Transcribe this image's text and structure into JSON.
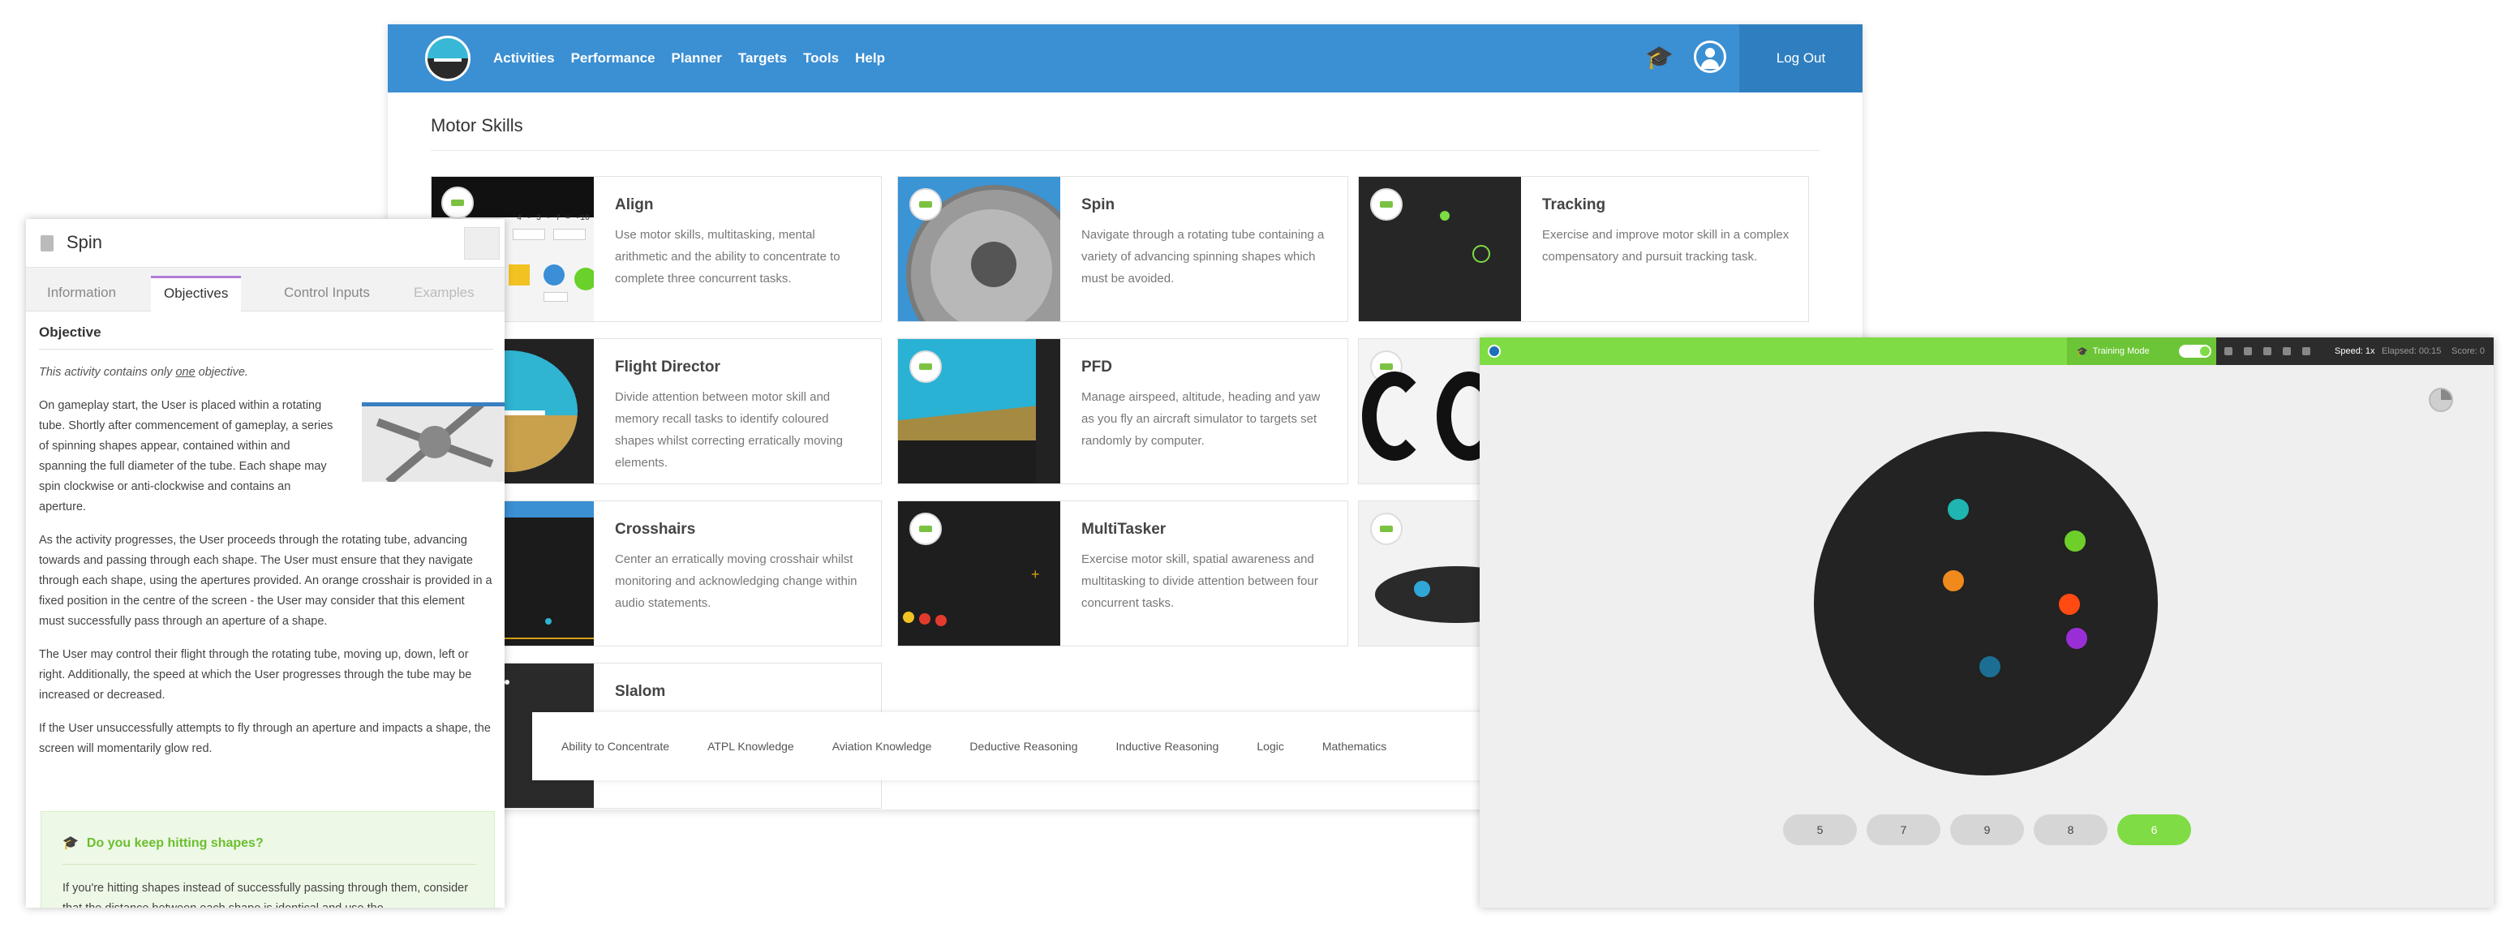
{
  "nav": {
    "links": [
      "Activities",
      "Performance",
      "Planner",
      "Targets",
      "Tools",
      "Help"
    ],
    "logout": "Log Out"
  },
  "section_title": "Motor Skills",
  "cards": [
    {
      "title": "Align",
      "desc": "Use motor skills, multitasking, mental arithmetic and the ability to concentrate to complete three concurrent tasks.",
      "thumb_text": "4 - 3 - 7 = -10"
    },
    {
      "title": "Spin",
      "desc": "Navigate through a rotating tube containing a variety of advancing spinning shapes which must be avoided."
    },
    {
      "title": "Tracking",
      "desc": "Exercise and improve motor skill in a complex compensatory and pursuit tracking task."
    },
    {
      "title": "Flight Director",
      "desc": "Divide attention between motor skill and memory recall tasks to identify coloured shapes whilst correcting erratically moving elements."
    },
    {
      "title": "PFD",
      "desc": "Manage airspeed, altitude, heading and yaw as you fly an aircraft simulator to targets set randomly by computer."
    },
    {
      "title": "Crosshairs",
      "desc": "Center an erratically moving crosshair whilst monitoring and acknowledging change within audio statements."
    },
    {
      "title": "MultiTasker",
      "desc": "Exercise motor skill, spatial awareness and multitasking to divide attention between four concurrent tasks."
    },
    {
      "title": "Slalom",
      "desc": ""
    }
  ],
  "filters": [
    "Ability to Concentrate",
    "ATPL Knowledge",
    "Aviation Knowledge",
    "Deductive Reasoning",
    "Inductive Reasoning",
    "Logic",
    "Mathematics"
  ],
  "spin_panel": {
    "title": "Spin",
    "tabs": [
      "Information",
      "Objectives",
      "Control Inputs",
      "Examples"
    ],
    "active_tab": "Objectives",
    "heading": "Objective",
    "intro_pre": "This activity contains only ",
    "intro_em": "one",
    "intro_post": " objective.",
    "para1": "On gameplay start, the User is placed within a rotating tube. Shortly after commencement of gameplay, a series of spinning shapes appear, contained within and spanning the full diameter of the tube. Each shape may spin clockwise or anti-clockwise and contains an aperture.",
    "para2": "As the activity progresses, the User proceeds through the rotating tube, advancing towards and passing through each shape. The User must ensure that they navigate through each shape, using the apertures provided. An orange crosshair is provided in a fixed position in the centre of the screen - the User may consider that this element must successfully pass through an aperture of a shape.",
    "para3": "The User may control their flight through the rotating tube, moving up, down, left or right. Additionally, the speed at which the User progresses through the tube may be increased or decreased.",
    "para4": "If the User unsuccessfully attempts to fly through an aperture and impacts a shape, the screen will momentarily glow red.",
    "tip_title": "Do you keep hitting shapes?",
    "tip_text": "If you're hitting shapes instead of successfully passing through them, consider that the distance between each shape is identical and use the"
  },
  "game": {
    "training_label": "Training Mode",
    "speed": "Speed: 1x",
    "elapsed": "Elapsed: 00:15",
    "score": "Score: 0",
    "answers": [
      "5",
      "7",
      "9",
      "8",
      "6"
    ],
    "selected_answer": "6",
    "dot_colors": [
      "#1fb5b0",
      "#6fcf2a",
      "#f08a1c",
      "#ff4a12",
      "#9a2ed6",
      "#1c6f93"
    ]
  }
}
